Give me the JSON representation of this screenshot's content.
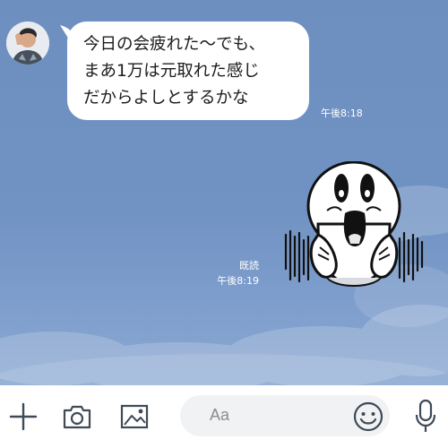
{
  "messages": [
    {
      "sender": "other",
      "lines": [
        "今日の会疲れた〜でも、",
        "まあ1万は元取れた感じ",
        "だからよしとするかな"
      ],
      "time": "午後8:18"
    },
    {
      "sender": "me",
      "type": "sticker",
      "read_label": "既読",
      "time": "午後8:19"
    }
  ],
  "toolbar": {
    "icons": [
      "plus-icon",
      "camera-icon",
      "image-icon",
      "emoji-icon",
      "mic-icon"
    ],
    "input_placeholder": "Aa"
  },
  "colors": {
    "background": "#7193c3",
    "bubble": "#ffffff",
    "toolbar_bg": "#ffffff",
    "icon": "#3f4a57"
  }
}
